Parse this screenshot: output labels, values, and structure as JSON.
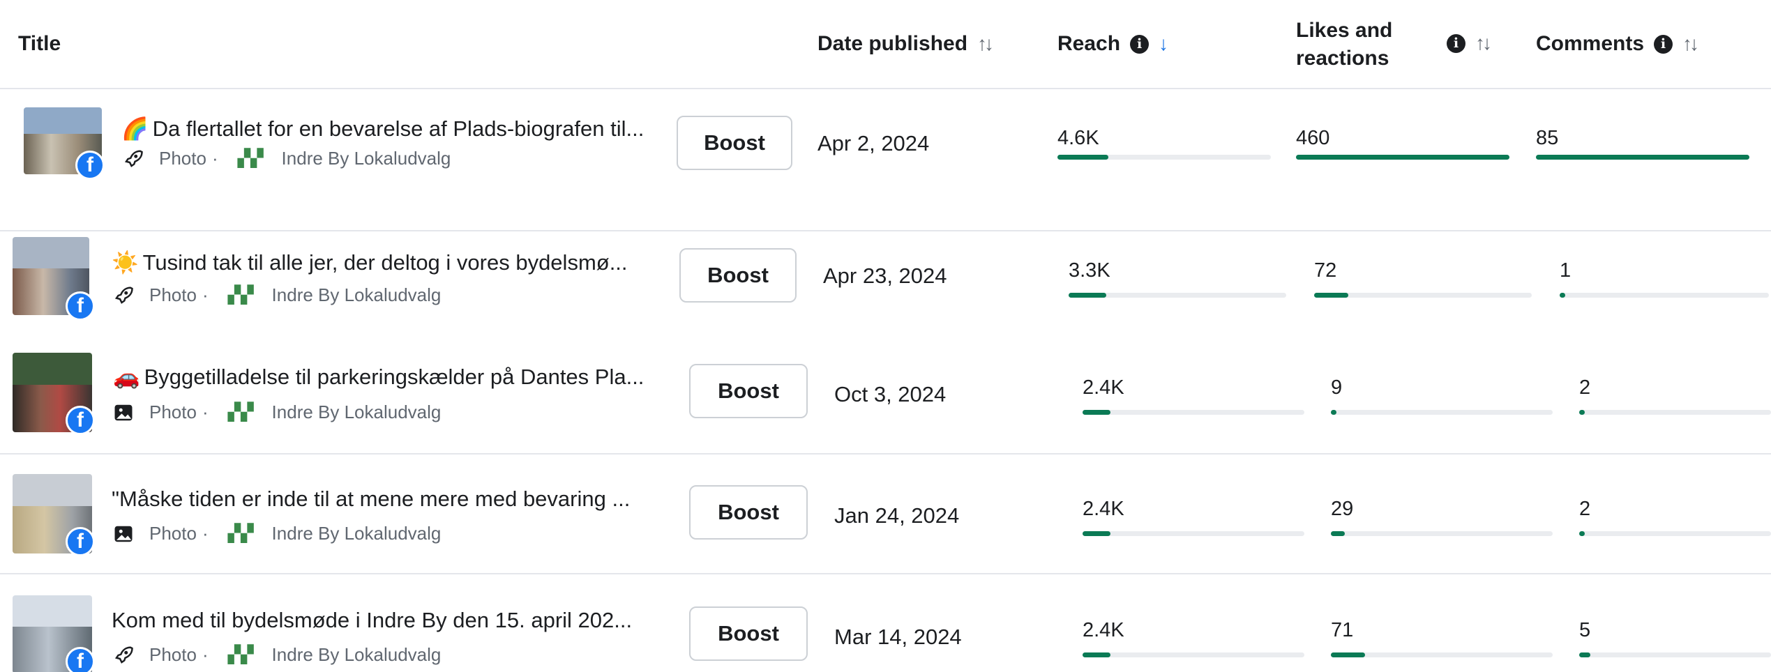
{
  "columns": {
    "title": "Title",
    "date": "Date published",
    "reach": "Reach",
    "likes_line1": "Likes and",
    "likes_line2": "reactions",
    "comments": "Comments"
  },
  "sort_icons": {
    "neutral": "↑↓",
    "active_desc": "↓"
  },
  "info_icon_label": "i",
  "boost_label": "Boost",
  "post_type": "Photo",
  "page_name": "Indre By Lokaludvalg",
  "max_values": {
    "reach": 4600,
    "likes": 460,
    "comments": 85
  },
  "posts": [
    {
      "emoji": "🌈",
      "title": "Da flertallet for en bevarelse af Plads-biografen til...",
      "icon": "rocket-icon",
      "date": "Apr 2, 2024",
      "reach": "4.6K",
      "reach_value": 4600,
      "likes": "460",
      "likes_value": 460,
      "comments": "85",
      "comments_value": 85
    },
    {
      "emoji": "☀️",
      "title": "Tusind tak til alle jer, der deltog i vores bydelsmø...",
      "icon": "rocket-icon",
      "date": "Apr 23, 2024",
      "reach": "3.3K",
      "reach_value": 3300,
      "likes": "72",
      "likes_value": 72,
      "comments": "1",
      "comments_value": 1
    },
    {
      "emoji": "🚗",
      "title": "Byggetilladelse til parkeringskælder på Dantes Pla...",
      "icon": "photo-icon",
      "date": "Oct 3, 2024",
      "reach": "2.4K",
      "reach_value": 2400,
      "likes": "9",
      "likes_value": 9,
      "comments": "2",
      "comments_value": 2
    },
    {
      "emoji": "",
      "title": "\"Måske tiden er inde til at mene mere med bevaring ...",
      "icon": "photo-icon",
      "date": "Jan 24, 2024",
      "reach": "2.4K",
      "reach_value": 2400,
      "likes": "29",
      "likes_value": 29,
      "comments": "2",
      "comments_value": 2
    },
    {
      "emoji": "",
      "title": "Kom med til bydelsmøde i Indre By den 15. april 202...",
      "icon": "rocket-icon",
      "date": "Mar 14, 2024",
      "reach": "2.4K",
      "reach_value": 2400,
      "likes": "71",
      "likes_value": 71,
      "comments": "5",
      "comments_value": 5
    }
  ],
  "colors": {
    "bar_fill": "#0b7a55",
    "bar_track": "#eaecef",
    "facebook": "#1877f2",
    "sort_active": "#1b74e4"
  }
}
